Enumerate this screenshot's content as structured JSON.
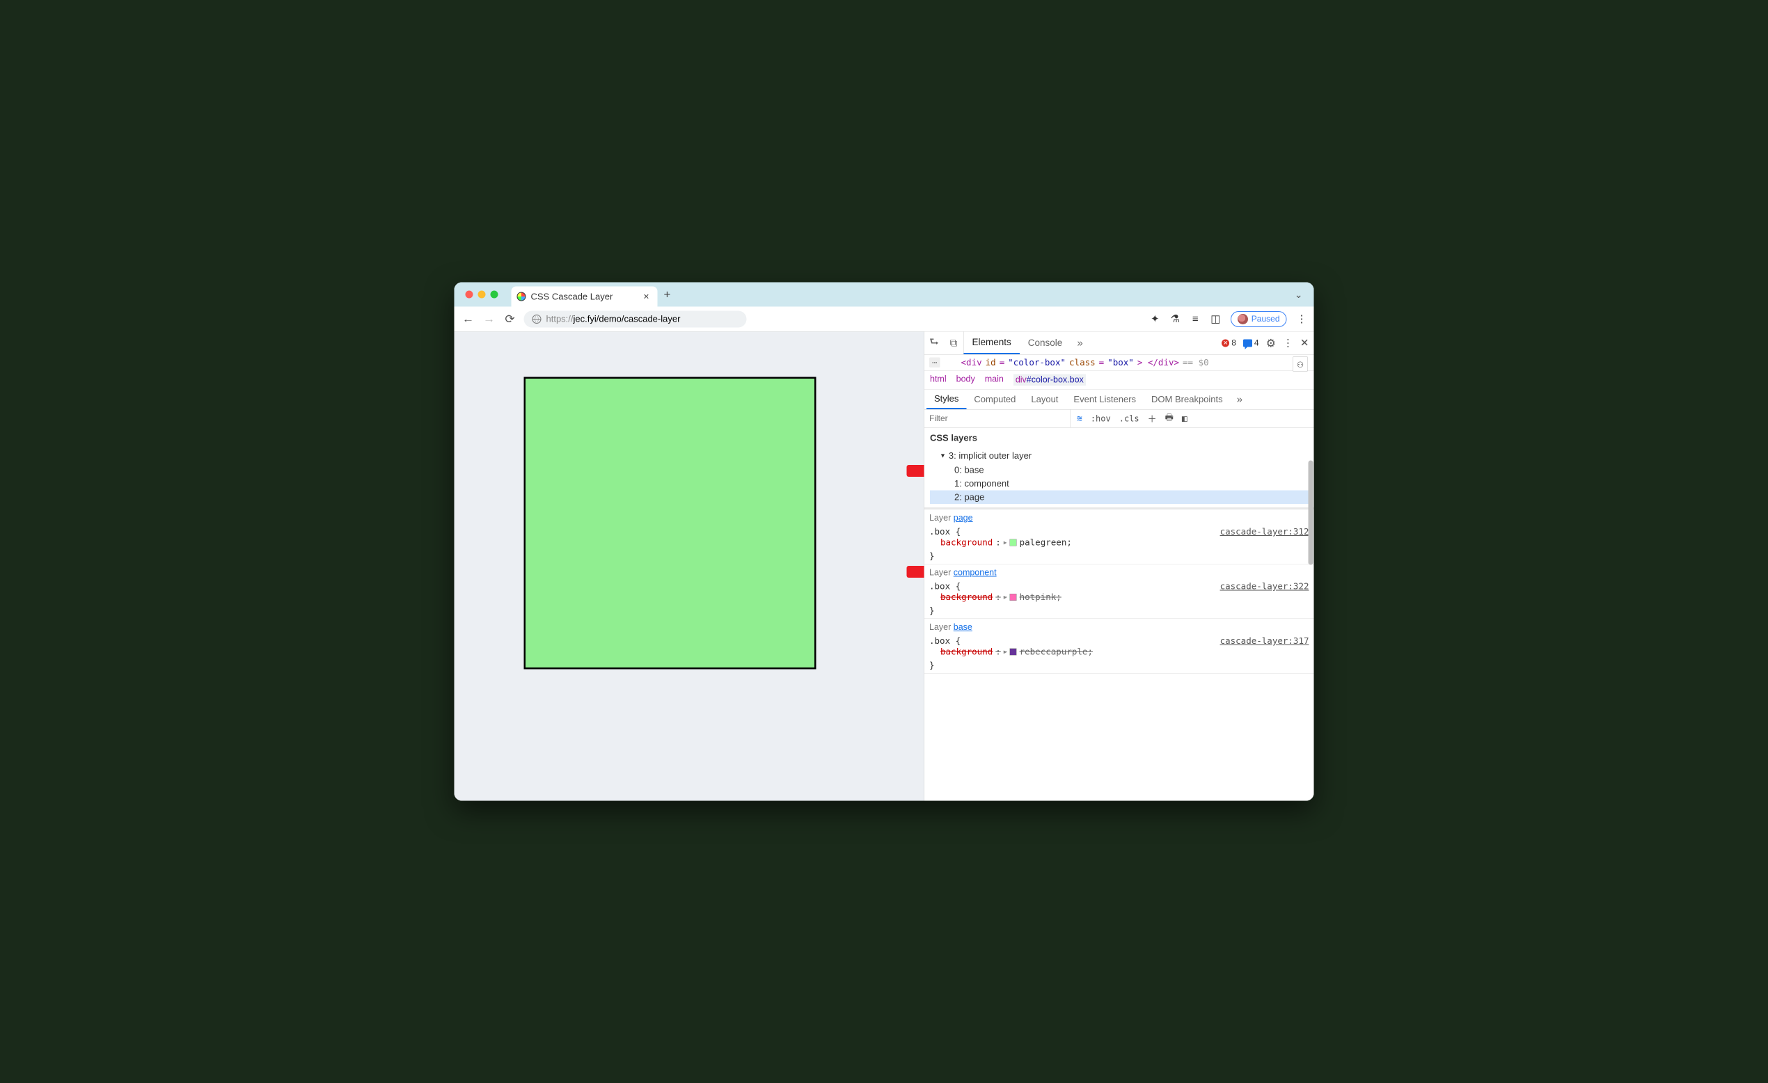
{
  "browser": {
    "tab_title": "CSS Cascade Layer",
    "close_glyph": "×",
    "newtab_glyph": "+",
    "url_scheme": "https://",
    "url_rest": "jec.fyi/demo/cascade-layer",
    "paused_label": "Paused"
  },
  "devtools": {
    "tabs": {
      "elements": "Elements",
      "console": "Console"
    },
    "error_count": "8",
    "message_count": "4",
    "source_line": {
      "open": "<div",
      "id_attr": "id",
      "id_val": "\"color-box\"",
      "class_attr": "class",
      "class_val": "\"box\"",
      "close": "> </div>",
      "hint": "== $0"
    },
    "breadcrumb": [
      "html",
      "body",
      "main"
    ],
    "breadcrumb_selected": {
      "tag": "div",
      "id": "#color-box",
      "cls": ".box"
    },
    "styles_tabs": [
      "Styles",
      "Computed",
      "Layout",
      "Event Listeners",
      "DOM Breakpoints"
    ],
    "filter_placeholder": "Filter",
    "hov": ":hov",
    "cls": ".cls",
    "layers": {
      "title": "CSS layers",
      "root": "3: implicit outer layer",
      "items": [
        "0: base",
        "1: component",
        "2: page"
      ]
    },
    "rules": [
      {
        "layer_label": "Layer ",
        "layer_link": "page",
        "selector": ".box {",
        "source": "cascade-layer:312",
        "prop_name": "background",
        "prop_value": "palegreen;",
        "swatch": "sw-palegreen",
        "overridden": false
      },
      {
        "layer_label": "Layer ",
        "layer_link": "component",
        "selector": ".box {",
        "source": "cascade-layer:322",
        "prop_name": "background",
        "prop_value": "hotpink;",
        "swatch": "sw-hotpink",
        "overridden": true
      },
      {
        "layer_label": "Layer ",
        "layer_link": "base",
        "selector": ".box {",
        "source": "cascade-layer:317",
        "prop_name": "background",
        "prop_value": "rebeccapurple;",
        "swatch": "sw-rebeccapurple",
        "overridden": true
      }
    ],
    "brace_close": "}"
  }
}
